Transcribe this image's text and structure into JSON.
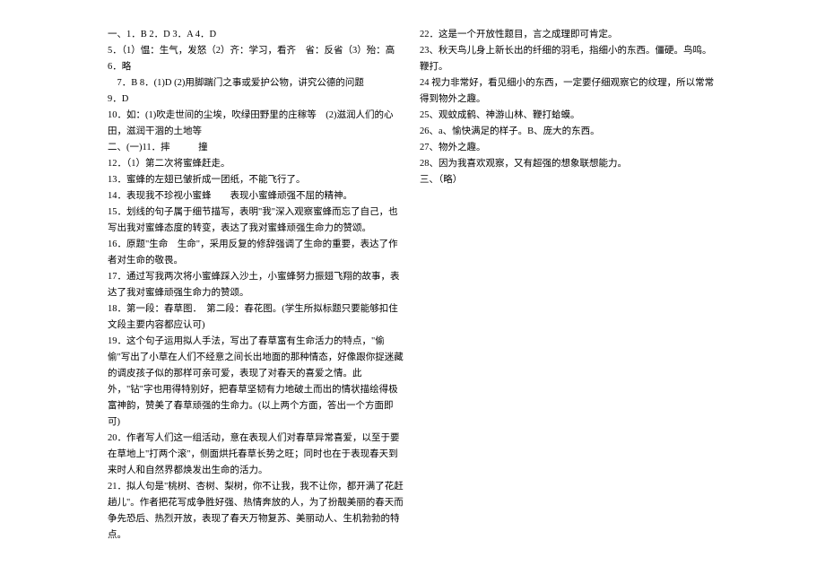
{
  "lines": [
    "一、1．B 2．D 3．A 4．D",
    "5．（1）愠：生气，发怒（2）齐：学习，看齐　省：反省（3）殆：高",
    "6．略",
    "　7．B 8．(1)D (2)用脚踹门之事或爱护公物，讲究公德的问题",
    "9．D",
    "10．如：(1)吹走世间的尘埃，吹绿田野里的庄稼等　(2)滋润人们的心田，滋润干涸的土地等",
    "二、(一)11．摔　　　撞",
    "12．（1）第二次将蜜蜂赶走。",
    "13．蜜蜂的左翅已皱折成一团纸，不能飞行了。",
    "14．表现我不珍视小蜜蜂　　表现小蜜蜂顽强不屈的精神。",
    "15．划线的句子属于细节描写，表明\"我\"深入观察蜜蜂而忘了自己，也写出我对蜜蜂态度的转变，表达了我对蜜蜂顽强生命力的赞颂。",
    "16．原题\"生命　生命\"，采用反复的修辞强调了生命的重要，表达了作者对生命的敬畏。",
    "17．通过写我两次将小蜜蜂踩入沙土，小蜜蜂努力振翅飞翔的故事，表达了我对蜜蜂顽强生命力的赞颂。",
    "18．第一段：春草图．　第二段：春花图。(学生所拟标题只要能够扣住文段主要内容都应认可)",
    "19．这个句子运用拟人手法，写出了春草富有生命活力的特点，\"偷偷\"写出了小草在人们不经意之间长出地面的那种情态，好像跟你捉迷藏的调皮孩子似的那样可亲可爱，表现了对春天的喜爱之情。此外，\"钻\"字也用得特别好，把春草坚韧有力地破土而出的情状描绘得极富神韵，赞美了春草顽强的生命力。(以上两个方面，答出一个方面即可)",
    "20．作者写人们这一组活动，意在表现人们对春草异常喜爱，以至于要在草地上\"打两个滚\"，侧面烘托春草长势之旺；同时也在于表现春天到来时人和自然界都焕发出生命的活力。",
    "21．拟人句是\"桃树、杏树、梨树，你不让我，我不让你，都开满了花赶趟儿\"。作者把花写成争胜好强、热情奔放的人，为了扮靓美丽的春天而争先恐后、热烈开放，表现了春天万物复苏、美丽动人、生机勃勃的特点。",
    "22．这是一个开放性题目，言之成理即可肯定。",
    "23、秋天鸟儿身上新长出的纤细的羽毛，指细小的东西。僵硬。鸟鸣。鞭打。",
    "24 视力非常好，看见细小的东西，一定要仔细观察它的纹理，所以常常得到物外之趣。",
    "25、观蚊成鹤、神游山林、鞭打蛤蟆。",
    "26、a、愉快满足的样子。B、庞大的东西。",
    "27、物外之趣。",
    "28、因为我喜欢观察，又有超强的想象联想能力。",
    "三、（略）"
  ]
}
